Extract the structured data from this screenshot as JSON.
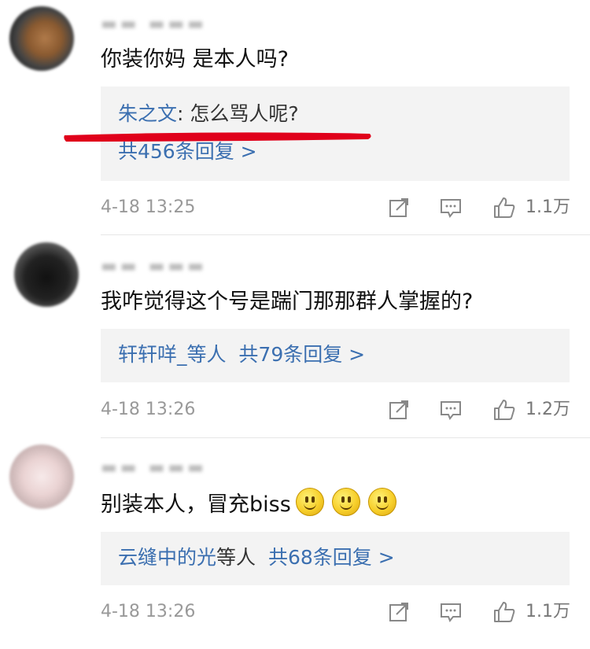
{
  "comments": [
    {
      "text": "你装你妈 是本人吗?",
      "reply": {
        "replier": "朱之文",
        "reply_text": ": 怎么骂人呢?",
        "count_text": "共456条回复 >"
      },
      "time": "4-18 13:25",
      "likes": "1.1万"
    },
    {
      "text": "我咋觉得这个号是踹门那那群人掌握的?",
      "reply": {
        "repliers": "轩轩咩_等人",
        "count_text": "共79条回复 >"
      },
      "time": "4-18 13:26",
      "likes": "1.2万"
    },
    {
      "text": "别装本人，冒充biss",
      "reply": {
        "replier": "云缝中的光",
        "others": "等人",
        "count_text": "共68条回复 >"
      },
      "time": "4-18 13:26",
      "likes": "1.1万"
    }
  ],
  "icons": {
    "share": "share-icon",
    "comment": "comment-icon",
    "like": "like-icon",
    "emoji": "smiley-emoji-icon"
  },
  "colors": {
    "link": "#3b6fb0",
    "annotation": "#e0001b"
  }
}
